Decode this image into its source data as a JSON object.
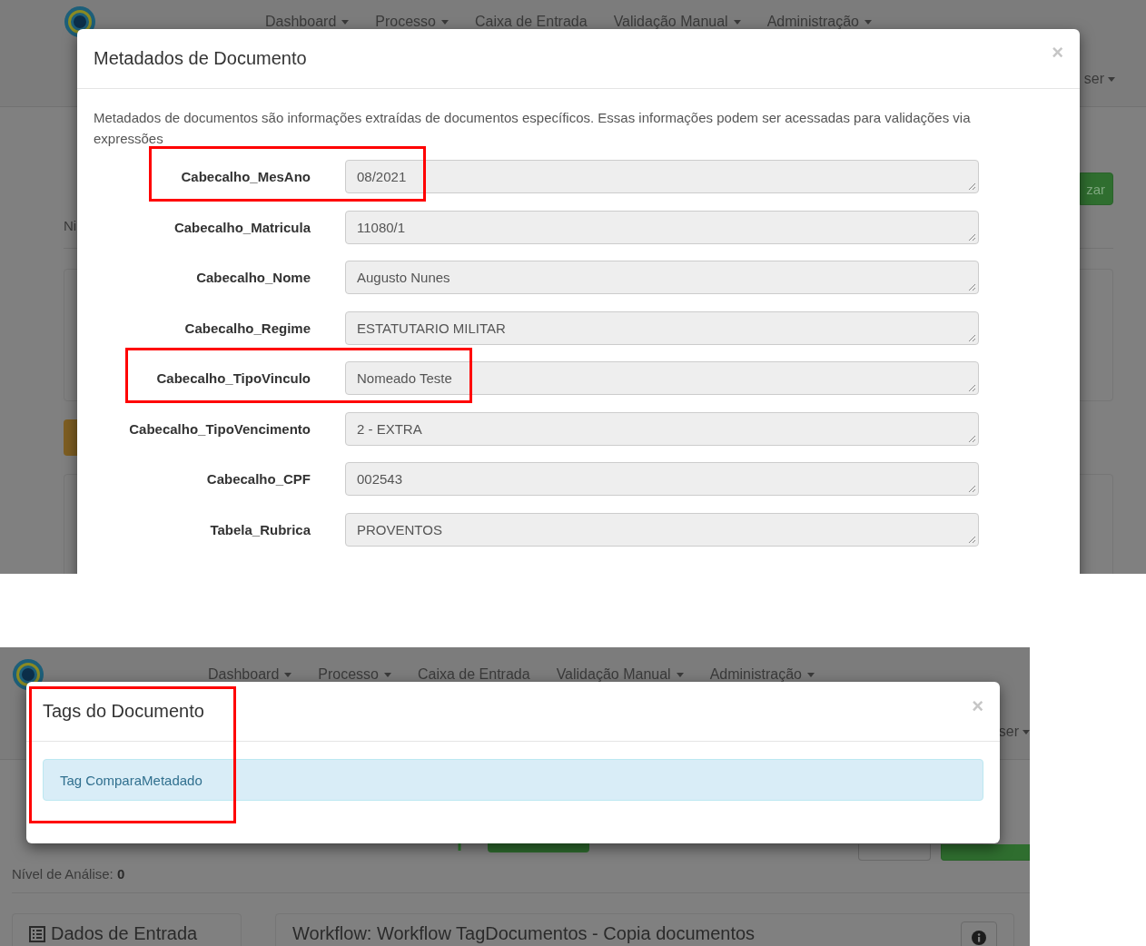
{
  "screenshot_1": {
    "background": {
      "nav": [
        {
          "label": "Dashboard",
          "dropdown": true
        },
        {
          "label": "Processo",
          "dropdown": true
        },
        {
          "label": "Caixa de Entrada",
          "dropdown": false
        },
        {
          "label": "Validação Manual",
          "dropdown": true
        },
        {
          "label": "Administração",
          "dropdown": true
        }
      ],
      "user_menu": "ser",
      "subtext": "Ni",
      "button": "zar"
    },
    "modal": {
      "title": "Metadados de Documento",
      "close": "×",
      "description": "Metadados de documentos são informações extraídas de documentos específicos. Essas informações podem ser acessadas para validações via expressões",
      "fields": [
        {
          "label": "Cabecalho_MesAno",
          "value": "08/2021",
          "highlighted": true
        },
        {
          "label": "Cabecalho_Matricula",
          "value": "11080/1",
          "highlighted": false
        },
        {
          "label": "Cabecalho_Nome",
          "value": "Augusto Nunes",
          "highlighted": false
        },
        {
          "label": "Cabecalho_Regime",
          "value": "ESTATUTARIO MILITAR",
          "highlighted": false
        },
        {
          "label": "Cabecalho_TipoVinculo",
          "value": "Nomeado Teste",
          "highlighted": true
        },
        {
          "label": "Cabecalho_TipoVencimento",
          "value": "2 - EXTRA",
          "highlighted": false
        },
        {
          "label": "Cabecalho_CPF",
          "value": "002543",
          "highlighted": false
        },
        {
          "label": "Tabela_Rubrica",
          "value": "PROVENTOS",
          "highlighted": false
        }
      ]
    }
  },
  "screenshot_2": {
    "background": {
      "nav": [
        {
          "label": "Dashboard",
          "dropdown": true
        },
        {
          "label": "Processo",
          "dropdown": true
        },
        {
          "label": "Caixa de Entrada",
          "dropdown": false
        },
        {
          "label": "Validação Manual",
          "dropdown": true
        },
        {
          "label": "Administração",
          "dropdown": true
        }
      ],
      "user_menu": "ser",
      "analysis_level_label": "Nível de Análise:",
      "analysis_level": "0",
      "panels": [
        "Dados de Entrada",
        "Workflow: Workflow TagDocumentos - Copia documentos"
      ]
    },
    "modal": {
      "title": "Tags do Documento",
      "close": "×",
      "highlighted": true,
      "tags": [
        {
          "label": "Tag ComparaMetadado"
        }
      ]
    }
  }
}
